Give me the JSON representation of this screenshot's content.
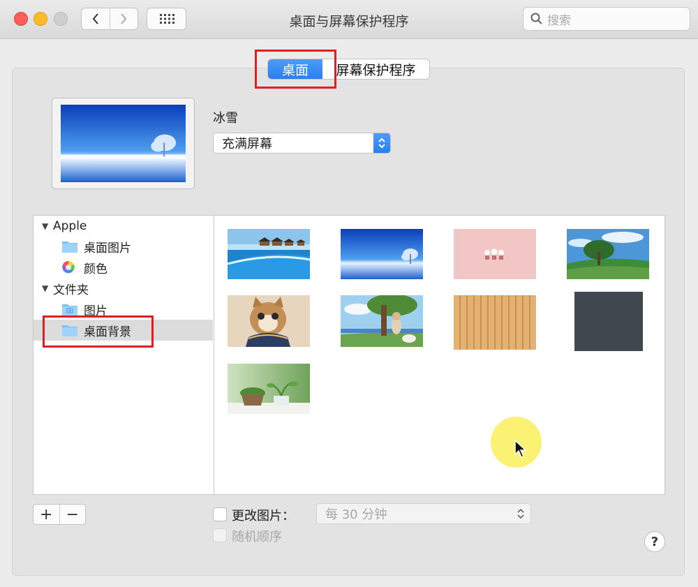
{
  "window": {
    "title": "桌面与屏幕保护程序",
    "search_placeholder": "搜索"
  },
  "tabs": [
    {
      "label": "桌面",
      "active": true
    },
    {
      "label": "屏幕保护程序",
      "active": false
    }
  ],
  "preview": {
    "wallpaper_name": "冰雪",
    "fit_option": "充满屏幕"
  },
  "sources": {
    "groups": [
      {
        "label": "Apple",
        "items": [
          {
            "label": "桌面图片",
            "icon": "folder-icon"
          },
          {
            "label": "颜色",
            "icon": "color-wheel-icon"
          }
        ]
      },
      {
        "label": "文件夹",
        "items": [
          {
            "label": "图片",
            "icon": "pictures-folder-icon"
          },
          {
            "label": "桌面背景",
            "icon": "folder-icon",
            "selected": true
          }
        ]
      }
    ]
  },
  "thumbnails": [
    {
      "name": "overwater-bungalows"
    },
    {
      "name": "snow-tree-sea"
    },
    {
      "name": "pink-cartoon"
    },
    {
      "name": "green-tree-field"
    },
    {
      "name": "cat"
    },
    {
      "name": "anime-girl-tree"
    },
    {
      "name": "wood-planks"
    },
    {
      "name": "dark-gray"
    },
    {
      "name": "potted-plants"
    }
  ],
  "controls": {
    "change_picture_label": "更改图片：",
    "interval_value": "每 30 分钟",
    "random_order_label": "随机顺序",
    "add_label": "+",
    "remove_label": "−",
    "help_label": "?"
  },
  "colors": {
    "accent": "#2a7ff0",
    "highlight_box": "#e02020"
  }
}
